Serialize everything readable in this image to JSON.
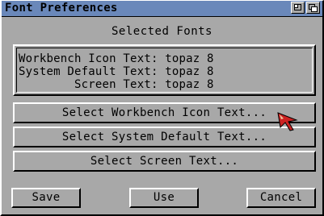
{
  "window": {
    "title": "Font Preferences",
    "gadgets": {
      "zoom_icon": "zoom-gadget",
      "depth_icon": "depth-gadget"
    }
  },
  "main": {
    "section_label": "Selected Fonts",
    "info_lines": [
      "Workbench Icon Text: topaz 8",
      "System Default Text: topaz 8",
      "        Screen Text: topaz 8"
    ],
    "select_buttons": [
      "Select Workbench Icon Text...",
      "Select System Default Text...",
      "Select Screen Text..."
    ]
  },
  "footer": {
    "save_label": "Save",
    "use_label": "Use",
    "cancel_label": "Cancel"
  },
  "colors": {
    "titlebar": "#6a88ba",
    "background": "#a8a8a8",
    "pointer": "#cc2222"
  }
}
